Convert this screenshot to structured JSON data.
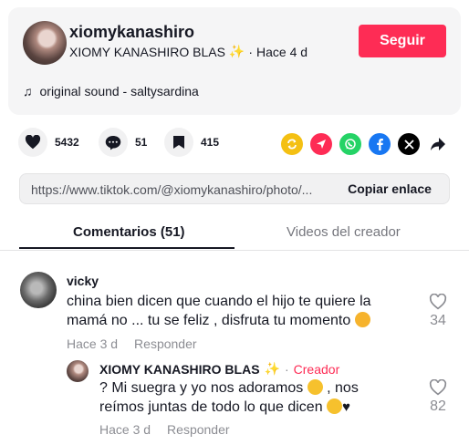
{
  "author": {
    "username": "xiomykanashiro",
    "nickname": "XIOMY KANASHIRO BLAS",
    "time_sep": "·",
    "time": "Hace 4 d",
    "follow_label": "Seguir",
    "sound": "original sound - saltysardina"
  },
  "actions": {
    "likes": "5432",
    "comments": "51",
    "saves": "415"
  },
  "share_icons": [
    "repost-icon",
    "send-icon",
    "whatsapp-icon",
    "facebook-icon",
    "x-icon",
    "share-arrow-icon"
  ],
  "link": {
    "url": "https://www.tiktok.com/@xiomykanashiro/photo/...",
    "copy_label": "Copiar enlace"
  },
  "tabs": {
    "comments": "Comentarios (51)",
    "creator_videos": "Videos del creador"
  },
  "comments": [
    {
      "user": "vicky",
      "text_line1": "china bien dicen que cuando el hijo te quiere la",
      "text_line2": "mamá no ... tu se feliz , disfruta tu momento",
      "time": "Hace 3 d",
      "reply_label": "Responder",
      "likes": "34",
      "replies": [
        {
          "user": "XIOMY KANASHIRO BLAS",
          "sep": "·",
          "badge": "Creador",
          "text_line1_a": "? Mi suegra y yo nos adoramos",
          "text_line1_b": ", nos",
          "text_line2": "reímos juntas de todo lo que dicen",
          "time": "Hace 3 d",
          "reply_label": "Responder",
          "likes": "82"
        }
      ]
    }
  ],
  "colors": {
    "accent": "#fe2c55",
    "repost": "#f4c013",
    "send": "#fe2c55",
    "whatsapp": "#25d366",
    "facebook": "#1877f2",
    "x": "#000000"
  }
}
